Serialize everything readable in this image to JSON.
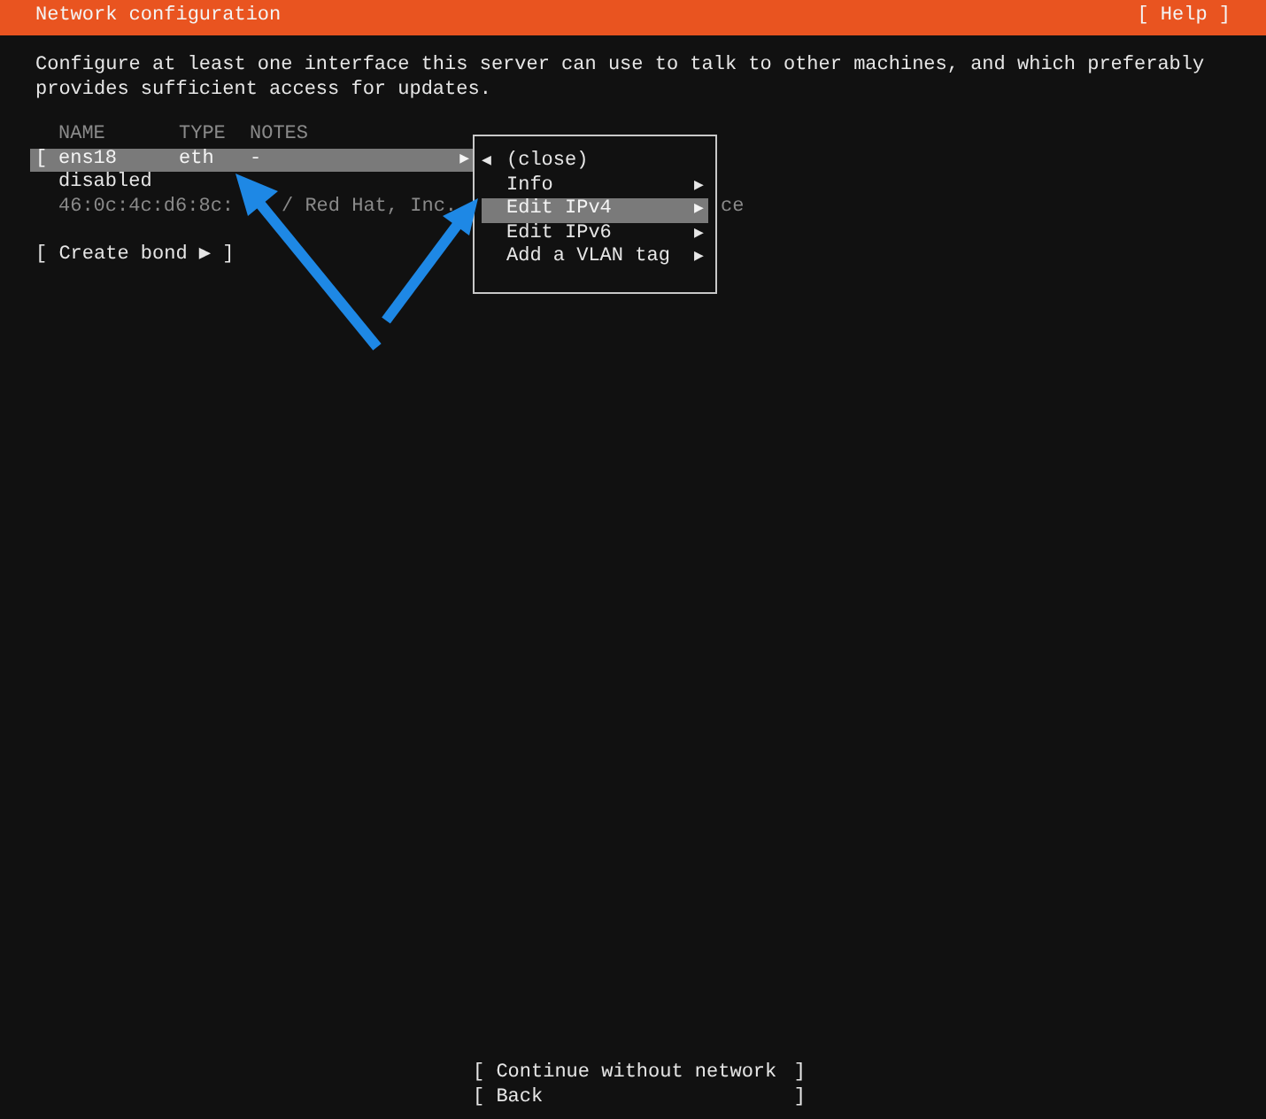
{
  "header": {
    "title": "Network configuration",
    "help": "[ Help ]"
  },
  "intro": "Configure at least one interface this server can use to talk to other machines, and which preferably provides sufficient access for updates.",
  "table": {
    "columns": [
      "NAME",
      "TYPE",
      "NOTES"
    ],
    "rows": [
      {
        "open": "[",
        "name": "ens18",
        "type": "eth",
        "notes": "-",
        "expander": "▶",
        "selected": true,
        "status": "disabled",
        "detail": "46:0c:4c:d6:8c:",
        "vendor": "/ Red Hat, Inc.",
        "tail": "ce"
      }
    ]
  },
  "create_bond": "[ Create bond ▶ ]",
  "menu": [
    {
      "kind": "back",
      "icon": "◀",
      "label": "(close)",
      "selected": false
    },
    {
      "kind": "submenu",
      "icon": "▶",
      "label": "Info",
      "selected": false
    },
    {
      "kind": "submenu",
      "icon": "▶",
      "label": "Edit IPv4",
      "selected": true
    },
    {
      "kind": "submenu",
      "icon": "▶",
      "label": "Edit IPv6",
      "selected": false
    },
    {
      "kind": "submenu",
      "icon": "▶",
      "label": "Add a VLAN tag",
      "selected": false
    }
  ],
  "buttons": [
    {
      "open": "[",
      "label": "Continue without network",
      "close": "]"
    },
    {
      "open": "[",
      "label": "Back",
      "close": "]"
    }
  ]
}
